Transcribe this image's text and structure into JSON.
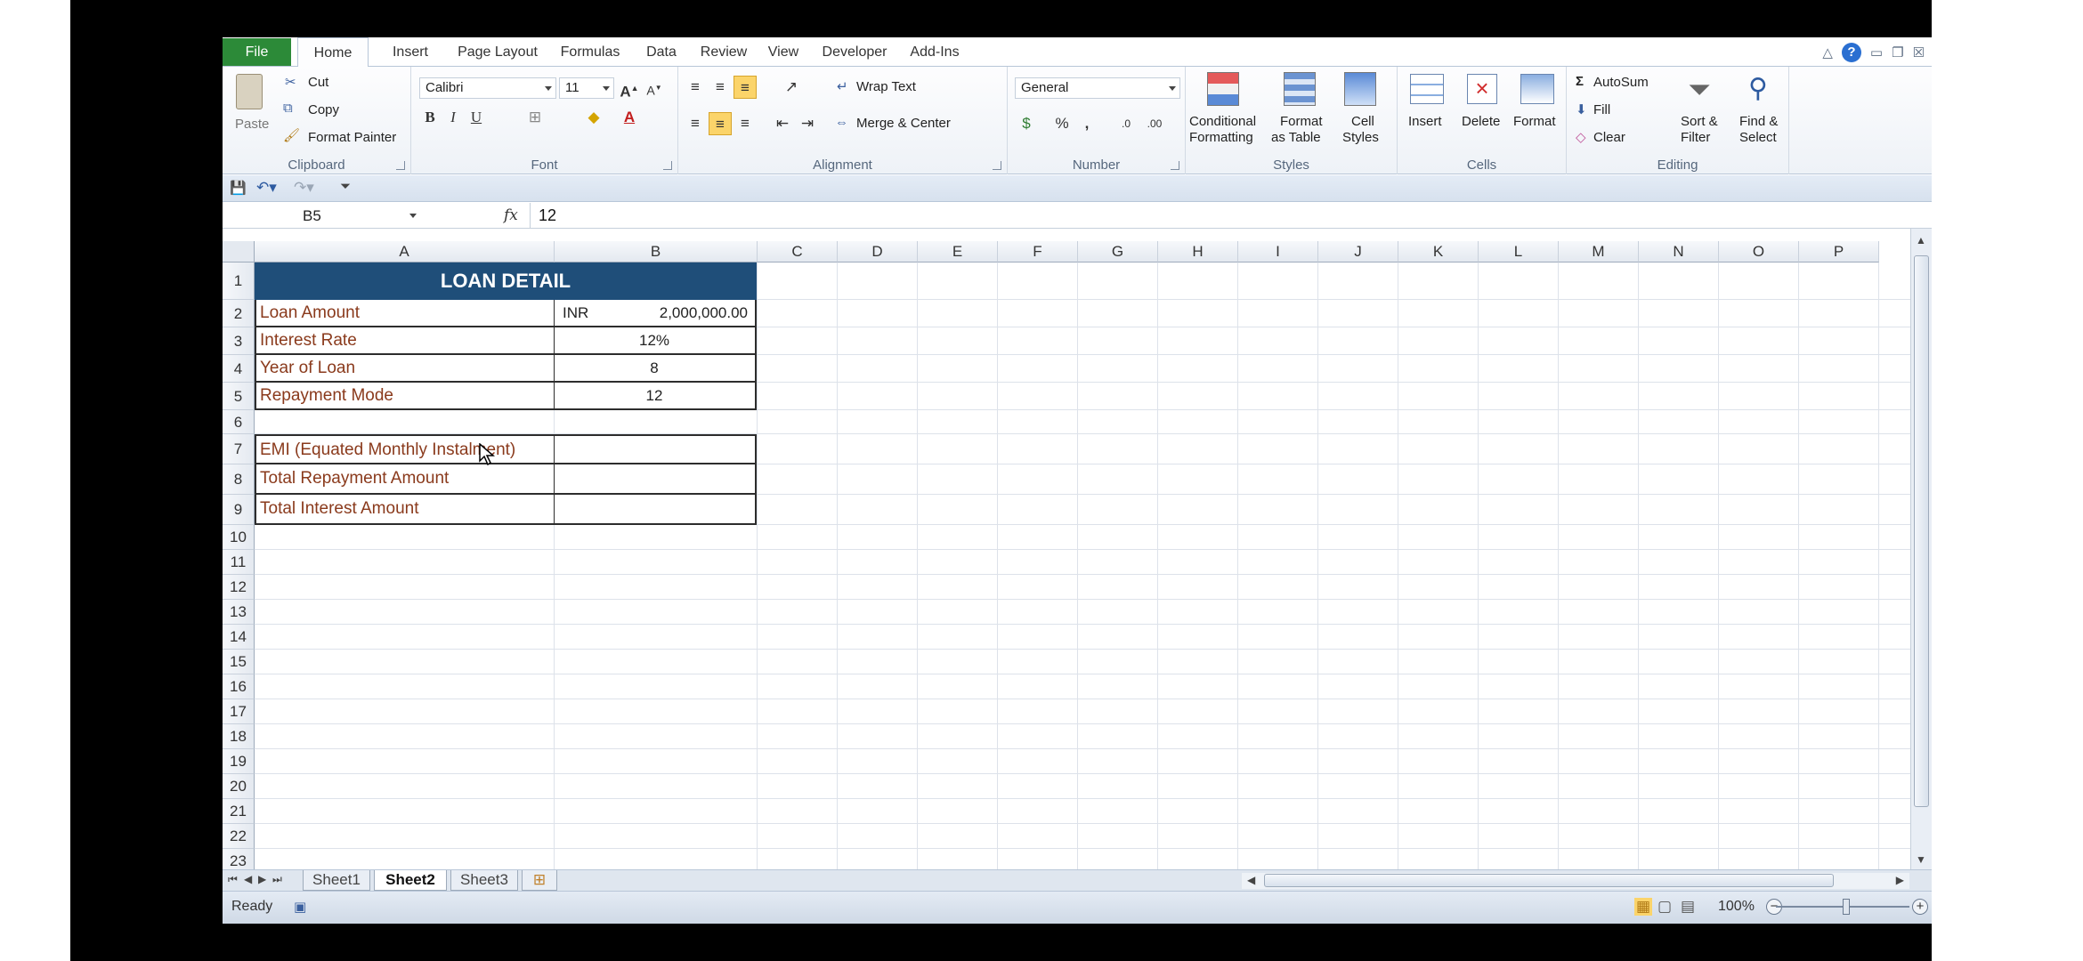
{
  "tabs": {
    "file": "File",
    "home": "Home",
    "insert": "Insert",
    "page_layout": "Page Layout",
    "formulas": "Formulas",
    "data": "Data",
    "review": "Review",
    "view": "View",
    "developer": "Developer",
    "addins": "Add-Ins"
  },
  "clipboard": {
    "paste": "Paste",
    "cut": "Cut",
    "copy": "Copy",
    "format_painter": "Format Painter",
    "label": "Clipboard"
  },
  "font": {
    "name": "Calibri",
    "size": "11",
    "label": "Font",
    "bold": "B",
    "italic": "I",
    "underline": "U"
  },
  "alignment": {
    "wrap_text": "Wrap Text",
    "merge_center": "Merge & Center",
    "label": "Alignment"
  },
  "number": {
    "format": "General",
    "percent": "%",
    "comma": ",",
    "label": "Number"
  },
  "styles": {
    "conditional_1": "Conditional",
    "conditional_2": "Formatting",
    "format_table_1": "Format",
    "format_table_2": "as Table",
    "cell_styles_1": "Cell",
    "cell_styles_2": "Styles",
    "label": "Styles"
  },
  "cells": {
    "insert": "Insert",
    "delete": "Delete",
    "format": "Format",
    "label": "Cells"
  },
  "editing": {
    "autosum": "AutoSum",
    "fill": "Fill",
    "clear": "Clear",
    "sort_1": "Sort &",
    "sort_2": "Filter",
    "find_1": "Find &",
    "find_2": "Select",
    "label": "Editing"
  },
  "formula_bar": {
    "name_box": "B5",
    "fx": "fx",
    "content": "12"
  },
  "columns": [
    "A",
    "B",
    "C",
    "D",
    "E",
    "F",
    "G",
    "H",
    "I",
    "J",
    "K",
    "L",
    "M",
    "N",
    "O",
    "P"
  ],
  "rows": [
    "1",
    "2",
    "3",
    "4",
    "5",
    "6",
    "7",
    "8",
    "9",
    "10",
    "11",
    "12",
    "13",
    "14",
    "15",
    "16",
    "17",
    "18",
    "19",
    "20",
    "21",
    "22",
    "23"
  ],
  "sheet": {
    "title": "LOAN DETAIL",
    "loan_amount_label": "Loan Amount",
    "loan_amount_currency": "INR",
    "loan_amount_value": "2,000,000.00",
    "interest_rate_label": "Interest Rate",
    "interest_rate_value": "12%",
    "year_label": "Year of Loan",
    "year_value": "8",
    "repayment_label": "Repayment Mode",
    "repayment_value": "12",
    "emi_label": "EMI (Equated Monthly Instalment)",
    "total_repayment_label": "Total Repayment Amount",
    "total_interest_label": "Total Interest Amount"
  },
  "sheet_tabs": [
    "Sheet1",
    "Sheet2",
    "Sheet3"
  ],
  "active_sheet": "Sheet2",
  "status": {
    "ready": "Ready",
    "zoom": "100%"
  },
  "colors": {
    "file_tab": "#2c8a38",
    "title_fill": "#1f4e79",
    "label_text": "#8a3a1c",
    "active_button": "#fbd46a"
  }
}
